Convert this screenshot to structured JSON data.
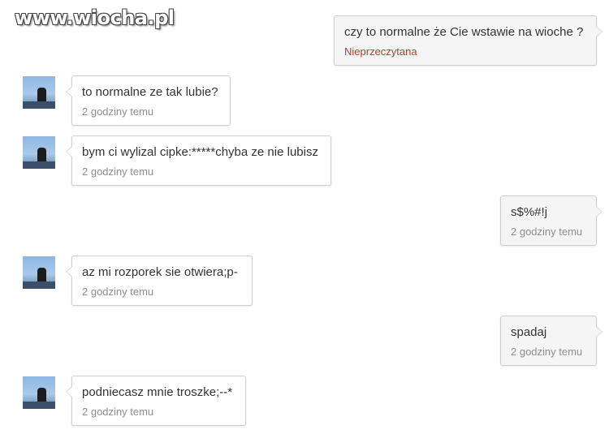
{
  "watermark": "www.wiocha.pl",
  "messages": [
    {
      "sender": "me",
      "text": "czy to normalne że Cie wstawie na wioche ?",
      "meta": "Nieprzeczytana"
    },
    {
      "sender": "them",
      "text": "to normalne ze tak lubie?",
      "meta": "2 godziny temu"
    },
    {
      "sender": "them",
      "text": "bym ci wylizal cipke:*****chyba ze nie lubisz",
      "meta": "2 godziny temu"
    },
    {
      "sender": "me",
      "text": "s$%#!j",
      "meta": "2 godziny temu"
    },
    {
      "sender": "them",
      "text": "az mi rozporek sie otwiera;p-",
      "meta": "2 godziny temu"
    },
    {
      "sender": "me",
      "text": "spadaj",
      "meta": "2 godziny temu"
    },
    {
      "sender": "them",
      "text": "podniecasz mnie troszke;--*",
      "meta": "2 godziny temu"
    }
  ],
  "colors": {
    "unread": "#c0392b",
    "timestamp": "#8e8e8e",
    "bubble_border": "#cfcfcf",
    "my_bubble_bg": "#f5f5f5"
  },
  "icons": {
    "avatar": "avatar-icon"
  }
}
